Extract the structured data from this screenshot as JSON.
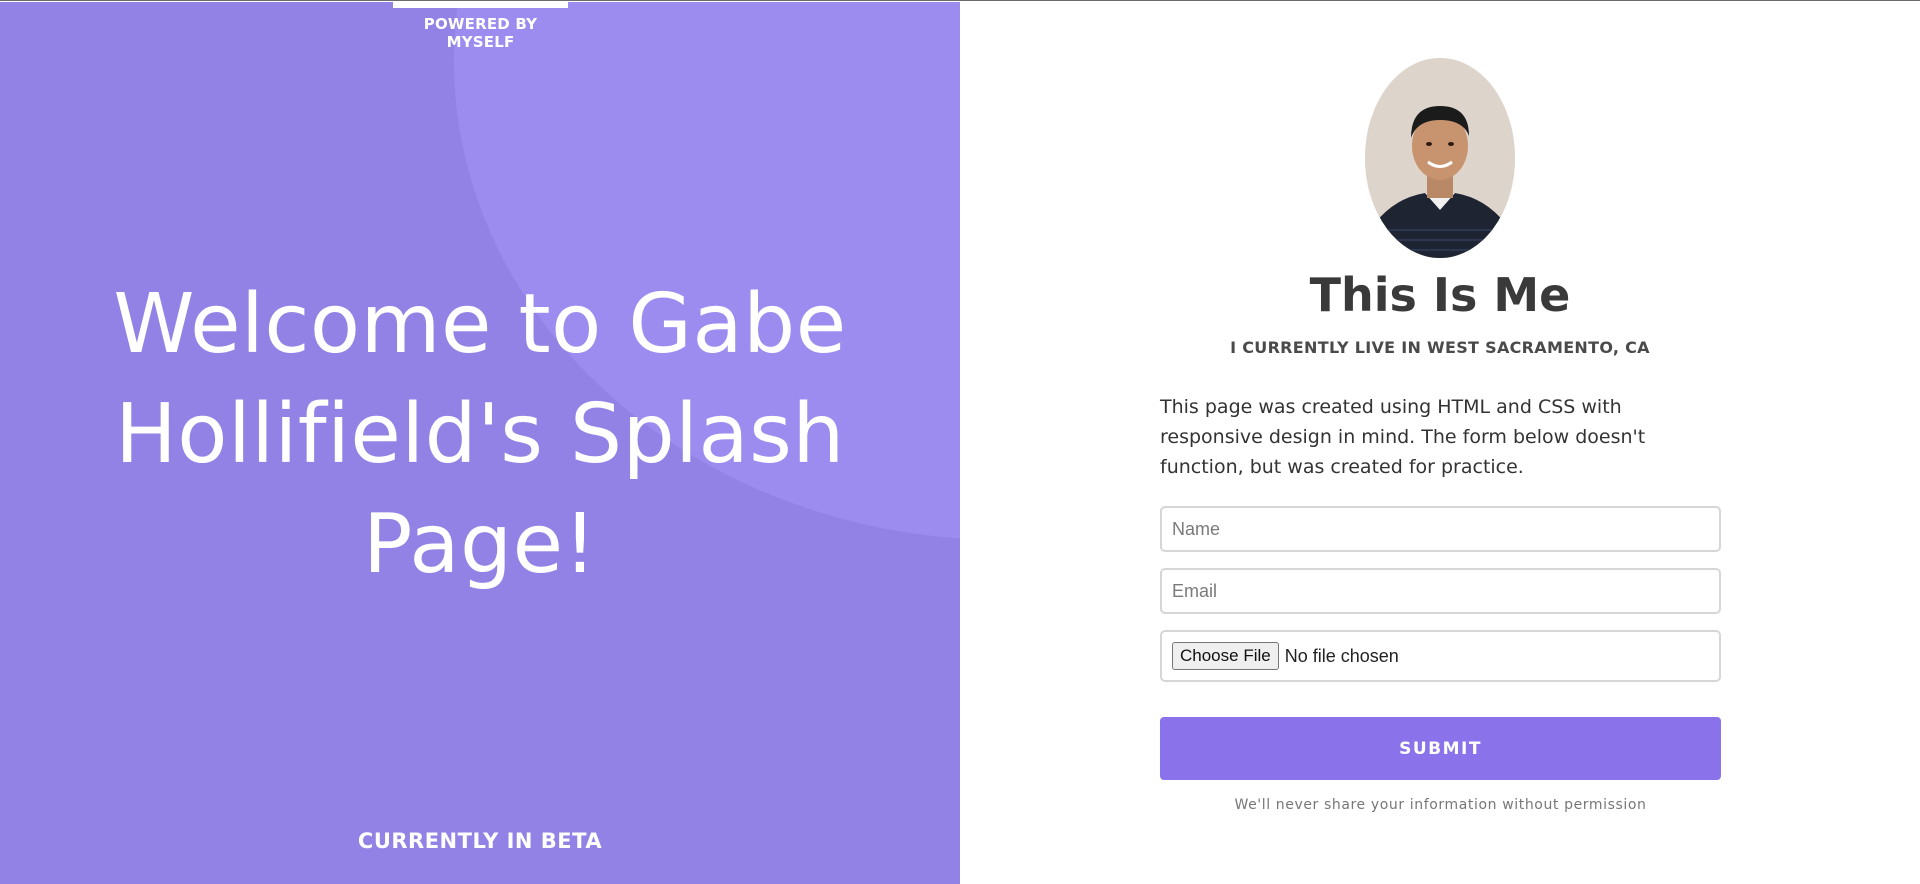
{
  "left_panel": {
    "powered_by": "POWERED BY MYSELF",
    "welcome_heading": "Welcome to Gabe Hollifield's Splash Page!",
    "beta_label": "CURRENTLY IN BETA",
    "colors": {
      "background": "#9382e6",
      "blob": "#9c8cf0"
    }
  },
  "right_panel": {
    "title": "This Is Me",
    "subtitle": "I CURRENTLY LIVE IN WEST SACRAMENTO, CA",
    "description": "This page was created using HTML and CSS with responsive design in mind. The form below doesn't function, but was created for practice.",
    "form": {
      "name_placeholder": "Name",
      "email_placeholder": "Email",
      "file_button_label": "Choose File",
      "file_status": "No file chosen",
      "submit_label": "SUBMIT",
      "privacy_note": "We'll never share your information without permission"
    },
    "colors": {
      "submit": "#8a73ea",
      "heading": "#3a3a3a"
    }
  }
}
